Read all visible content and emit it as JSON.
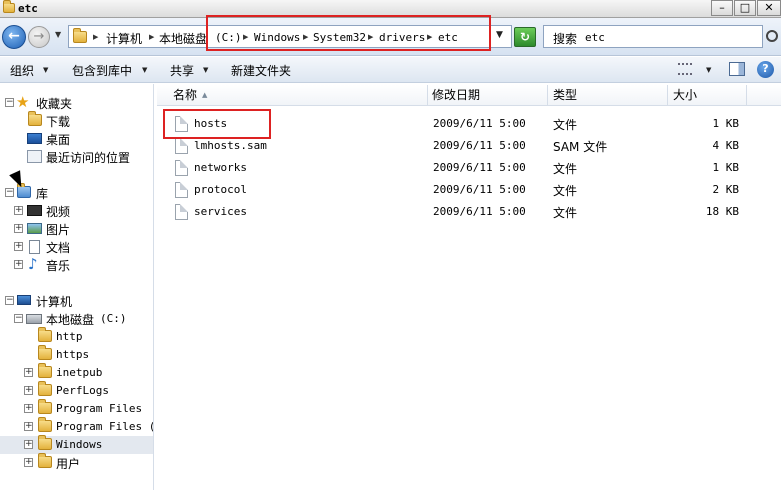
{
  "window": {
    "title": "etc",
    "min_label": "–",
    "max_label": "□",
    "close_label": "✕"
  },
  "address": {
    "crumbs": [
      {
        "label": "计算机",
        "mono": false
      },
      {
        "label": "本地磁盘",
        "mono": false
      },
      {
        "label": "(C:)",
        "mono": true
      },
      {
        "label": "Windows",
        "mono": true
      },
      {
        "label": "System32",
        "mono": true
      },
      {
        "label": "drivers",
        "mono": true
      },
      {
        "label": "etc",
        "mono": true
      }
    ],
    "back_glyph": "←",
    "forward_glyph": "→",
    "refresh_glyph": "↻"
  },
  "search": {
    "prefix": "搜索",
    "scope": "etc"
  },
  "toolbar": {
    "organize": "组织",
    "include_library": "包含到库中",
    "share": "共享",
    "new_folder": "新建文件夹",
    "help_glyph": "?"
  },
  "nav": {
    "favorites": {
      "label": "收藏夹",
      "items": [
        "下载",
        "桌面",
        "最近访问的位置"
      ]
    },
    "libraries": {
      "label": "库",
      "items": [
        "视频",
        "图片",
        "文档",
        "音乐"
      ]
    },
    "computer": {
      "label": "计算机",
      "drive_name": "本地磁盘",
      "drive_letter": "(C:)",
      "folders": [
        "http",
        "https",
        "inetpub",
        "PerfLogs",
        "Program Files",
        "Program Files (x",
        "Windows",
        "用户"
      ],
      "selected": "Windows"
    }
  },
  "columns": {
    "name": "名称",
    "modified": "修改日期",
    "type": "类型",
    "size": "大小"
  },
  "files": [
    {
      "name": "hosts",
      "modified": "2009/6/11 5:00",
      "type": "文件",
      "size": "1 KB"
    },
    {
      "name": "lmhosts.sam",
      "modified": "2009/6/11 5:00",
      "type": "SAM 文件",
      "size": "4 KB"
    },
    {
      "name": "networks",
      "modified": "2009/6/11 5:00",
      "type": "文件",
      "size": "1 KB"
    },
    {
      "name": "protocol",
      "modified": "2009/6/11 5:00",
      "type": "文件",
      "size": "2 KB"
    },
    {
      "name": "services",
      "modified": "2009/6/11 5:00",
      "type": "文件",
      "size": "18 KB"
    }
  ],
  "colors": {
    "highlight": "#dd2222",
    "selection": "#e3e8ef",
    "folder": "#e3b23c"
  }
}
